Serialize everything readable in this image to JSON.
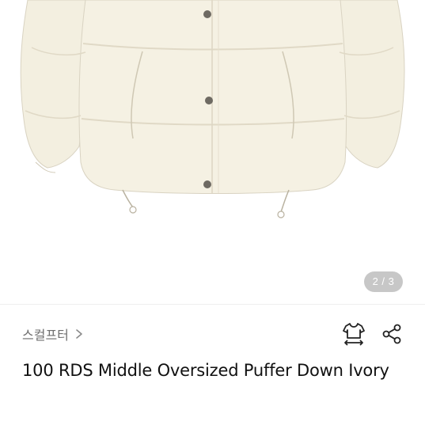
{
  "gallery": {
    "image_alt": "ivory puffer down jacket",
    "page_indicator": "2 / 3"
  },
  "shop": {
    "name": "스컬프터",
    "chevron_icon": "chevron-right-icon"
  },
  "actions": {
    "size_icon": "tshirt-size-icon",
    "share_icon": "share-icon"
  },
  "product": {
    "title": "100 RDS Middle Oversized Puffer Down Ivory"
  },
  "colors": {
    "jacket": "#f4f0e2",
    "jacket_shadow": "#e2dccb",
    "indicator_bg": "#b5b5b5",
    "title_text": "#111111",
    "shop_text": "#6e6e6e"
  }
}
